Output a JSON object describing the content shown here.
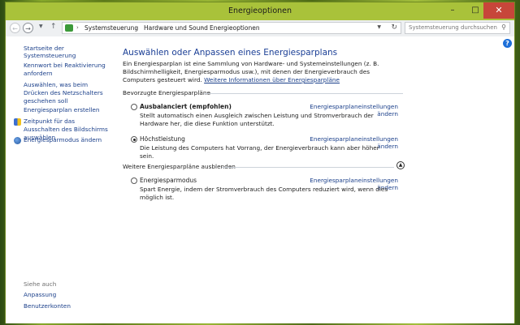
{
  "window": {
    "title": "Energieoptionen",
    "minimize": "–",
    "maximize": "□",
    "close": "✕"
  },
  "addressbar": {
    "back": "←",
    "forward": "→",
    "up": "↑",
    "breadcrumbs": [
      "Systemsteuerung",
      "Hardware und Sound",
      "Energieoptionen"
    ],
    "separator": "›",
    "search_placeholder": "Systemsteuerung durchsuchen"
  },
  "sidebar": {
    "home": "Startseite der Systemsteuerung",
    "links": [
      "Kennwort bei Reaktivierung anfordern",
      "Auswählen, was beim Drücken des Netzschalters geschehen soll",
      "Energiesparplan erstellen",
      "Zeitpunkt für das Ausschalten des Bildschirms auswählen",
      "Energiesparmodus ändern"
    ],
    "see_also": "Siehe auch",
    "see_also_links": [
      "Anpassung",
      "Benutzerkonten"
    ]
  },
  "main": {
    "title": "Auswählen oder Anpassen eines Energiesparplans",
    "intro": "Ein Energiesparplan ist eine Sammlung von Hardware- und Systemeinstellungen (z. B. Bildschirmhelligkeit, Energiesparmodus usw.), mit denen der Energieverbrauch des Computers gesteuert wird.",
    "intro_link": "Weitere Informationen über Energiesparpläne",
    "preferred_heading": "Bevorzugte Energiesparpläne",
    "hidden_heading": "Weitere Energiesparpläne ausblenden",
    "change_link": "Energiesparplaneinstellungen ändern",
    "plans": [
      {
        "name": "Ausbalanciert (empfohlen)",
        "desc": "Stellt automatisch einen Ausgleich zwischen Leistung und Stromverbrauch der Hardware her, die diese Funktion unterstützt.",
        "selected": false
      },
      {
        "name": "Höchstleistung",
        "desc": "Die Leistung des Computers hat Vorrang, der Energieverbrauch kann aber höher sein.",
        "selected": true
      },
      {
        "name": "Energiesparmodus",
        "desc": "Spart Energie, indem der Stromverbrauch des Computers reduziert wird, wenn dies möglich ist.",
        "selected": false
      }
    ]
  }
}
